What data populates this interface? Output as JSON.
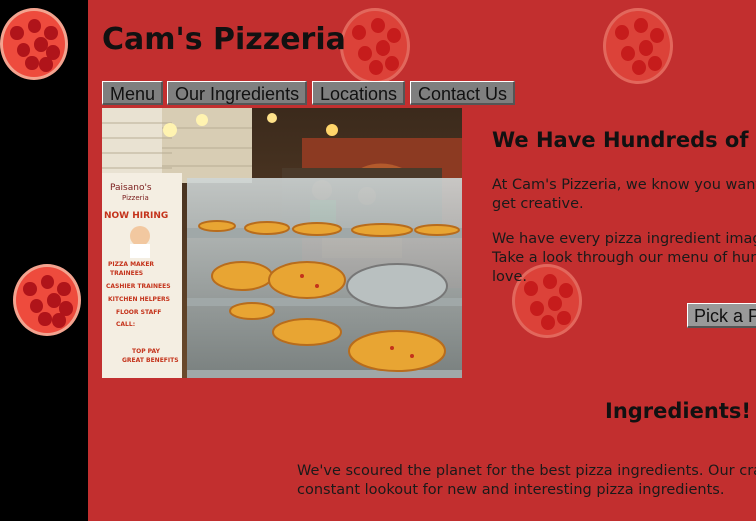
{
  "site": {
    "title": "Cam's Pizzeria"
  },
  "nav": {
    "items": [
      "Menu",
      "Our Ingredients",
      "Locations",
      "Contact Us"
    ]
  },
  "photo": {
    "description_icon": "pizzeria-counter-photo",
    "banner_brand": "Paisano's",
    "banner_sub": "Pizzeria",
    "banner_hiring": "NOW HIRING",
    "banner_lines": [
      "PIZZA MAKER",
      "TRAINEES",
      "CASHIER TRAINEES",
      "KITCHEN HELPERS",
      "FLOOR STAFF",
      "CALL:",
      "TOP PAY",
      "GREAT BENEFITS"
    ]
  },
  "hero": {
    "headline": "We Have Hundreds of P",
    "para1_line1": "At Cam's Pizzeria, we know you want",
    "para1_line2": "get creative.",
    "para2_line1": "We have every pizza ingredient imag",
    "para2_line2": "Take a look through our menu of hun",
    "para2_line3": "love.",
    "button": "Pick a P"
  },
  "ingredients": {
    "title": "Ingredients!",
    "line1": "We've scoured the planet for the best pizza ingredients. Our cra",
    "line2": "constant lookout for new and interesting pizza ingredients."
  },
  "colors": {
    "background": "#c22f2f",
    "sidebar": "#000000",
    "nav_button": "#7f7f7f"
  }
}
